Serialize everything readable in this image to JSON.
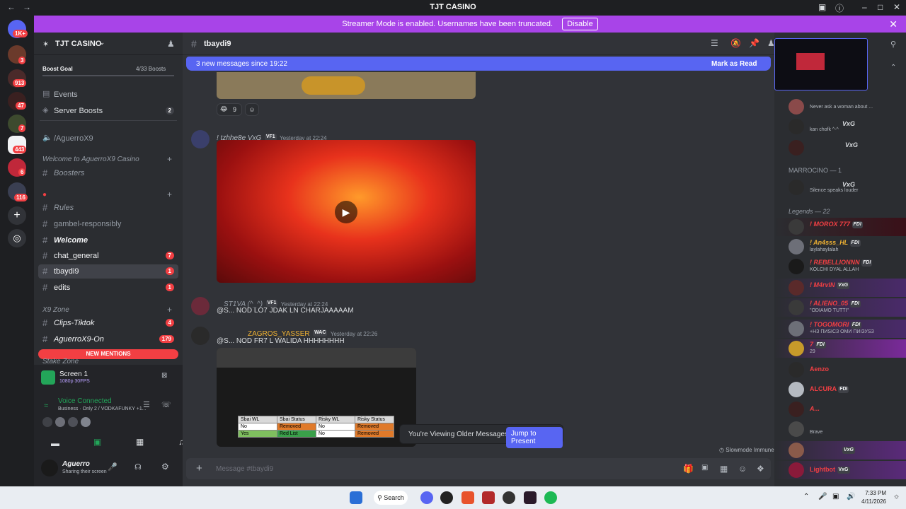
{
  "titlebar": {
    "title": "TJT CASINO"
  },
  "banner": {
    "text": "Streamer Mode is enabled. Usernames have been truncated.",
    "disable": "Disable"
  },
  "rail": {
    "badges": [
      "1K+",
      "3",
      "913",
      "47",
      "7",
      "443",
      "6",
      "116"
    ]
  },
  "sidebar": {
    "server_name": "TJT CASINO",
    "boost_goal": "Boost Goal",
    "boost_count": "4/33 Boosts",
    "events": "Events",
    "server_boosts": "Server Boosts",
    "server_boosts_count": "2",
    "voice_channel": "/AguerroX9",
    "category_welcome": "Welcome to AguerroX9 Casino",
    "channels": [
      {
        "label": "Boosters",
        "count": ""
      },
      {
        "label": "Rules",
        "count": ""
      },
      {
        "label": "gambel-responsibly",
        "count": ""
      },
      {
        "label": "Welcome",
        "count": ""
      },
      {
        "label": "chat_general",
        "count": "7"
      },
      {
        "label": "tbaydi9",
        "count": "1"
      },
      {
        "label": "edits",
        "count": "1"
      },
      {
        "label": "Clips-Tiktok",
        "count": "4"
      },
      {
        "label": "AguerroX9-On",
        "count": "179"
      }
    ],
    "category_x9": "X9 Zone",
    "category_stake": "Stake Zone",
    "new_mentions": "NEW MENTIONS"
  },
  "userpanel": {
    "screen_title": "Screen 1",
    "screen_sub": "1080p 30FPS",
    "voice_status": "Voice Connected",
    "voice_sub": "Business · Only 2 / VODKAFUNKY +1...",
    "username": "Aguerro",
    "user_status": "Sharing their screen"
  },
  "main": {
    "channel": "tbaydi9",
    "new_messages": "3 new messages since 19:22",
    "mark_read": "Mark as Read",
    "reaction_count": "9",
    "messages": [
      {
        "name": "! tzhhe8e VxG",
        "tag": "VF1",
        "time": "Yesterday at 22:24",
        "text": ""
      },
      {
        "name": "ST1VA (^_^)",
        "tag": "VF1",
        "time": "Yesterday at 22:24",
        "text": "@S...  NOD LO7 JDAK LN CHARJAAAAAM"
      },
      {
        "name": "ZAGROS_YASSER",
        "tag": "WAC",
        "time": "Yesterday at 22:26",
        "text": "@S...  NOD FR7 L WALIDA HHHHHHHH"
      }
    ],
    "table": {
      "headers": [
        "Sbai WL",
        "Sbai Status",
        "Risky WL",
        "Risky Status"
      ],
      "rows": [
        [
          "No",
          "Removed",
          "No",
          "Removed"
        ],
        [
          "Yes",
          "Red List",
          "No",
          "Removed"
        ]
      ]
    },
    "older_text": "You're Viewing Older Messages",
    "jump": "Jump to Present",
    "slowmode": "Slowmode Immune",
    "composer_placeholder": "Message #tbaydi9"
  },
  "members": {
    "entries": [
      {
        "name": "",
        "status": "Never ask a woman about ...",
        "color": "#dbdee1"
      },
      {
        "name": "VxG",
        "status": "kan chofk ^-^",
        "color": "#dbdee1"
      },
      {
        "name": "VxG",
        "status": "",
        "color": "#dbdee1"
      }
    ],
    "section_marrocino": "MARROCINO — 1",
    "marrocino_member": {
      "name": "VxG",
      "status": "Silence speaks louder"
    },
    "section_legends": "Legends — 22",
    "legends": [
      {
        "name": "! MOROX 777",
        "tag": "FDI",
        "status": "",
        "color": "#f23f43"
      },
      {
        "name": "! An4sss_HL",
        "tag": "FDI",
        "status": "laylahaylalah",
        "color": "#f0b232"
      },
      {
        "name": "! REBELLIONNN",
        "tag": "FDI",
        "status": "KOLCHI DYAL ALLAH",
        "color": "#f23f43"
      },
      {
        "name": "! M4rvIN",
        "tag": "VxG",
        "status": "",
        "color": "#f23f43"
      },
      {
        "name": "! ALIENO_05",
        "tag": "FDI",
        "status": "\"ODIAMO TUTTI\"",
        "color": "#f23f43"
      },
      {
        "name": "! TOGOMORI",
        "tag": "FDI",
        "status": "+НЗ ПИЅІСЗ ОМИ ПИІЗУЅЗ",
        "color": "#f23f43"
      },
      {
        "name": "7",
        "tag": "FDI",
        "status": "29",
        "color": "#f23f43"
      },
      {
        "name": "Aenzo",
        "tag": "",
        "status": "",
        "color": "#f23f43"
      },
      {
        "name": "ALCURA",
        "tag": "FDI",
        "status": "",
        "color": "#f23f43"
      },
      {
        "name": "A...",
        "tag": "",
        "status": "",
        "color": "#f23f43"
      },
      {
        "name": "",
        "tag": "",
        "status": "Brave",
        "color": "#f23f43"
      },
      {
        "name": "",
        "tag": "VxG",
        "status": "",
        "color": "#f23f43"
      },
      {
        "name": "Lightbot",
        "tag": "VxG",
        "status": "",
        "color": "#f23f43"
      }
    ]
  },
  "taskbar": {
    "search": "Search",
    "time": "7:33 PM",
    "date": "4/11/2026"
  },
  "colors": {
    "accent": "#5865f2",
    "banner": "#a844e8",
    "red": "#f23f43"
  }
}
